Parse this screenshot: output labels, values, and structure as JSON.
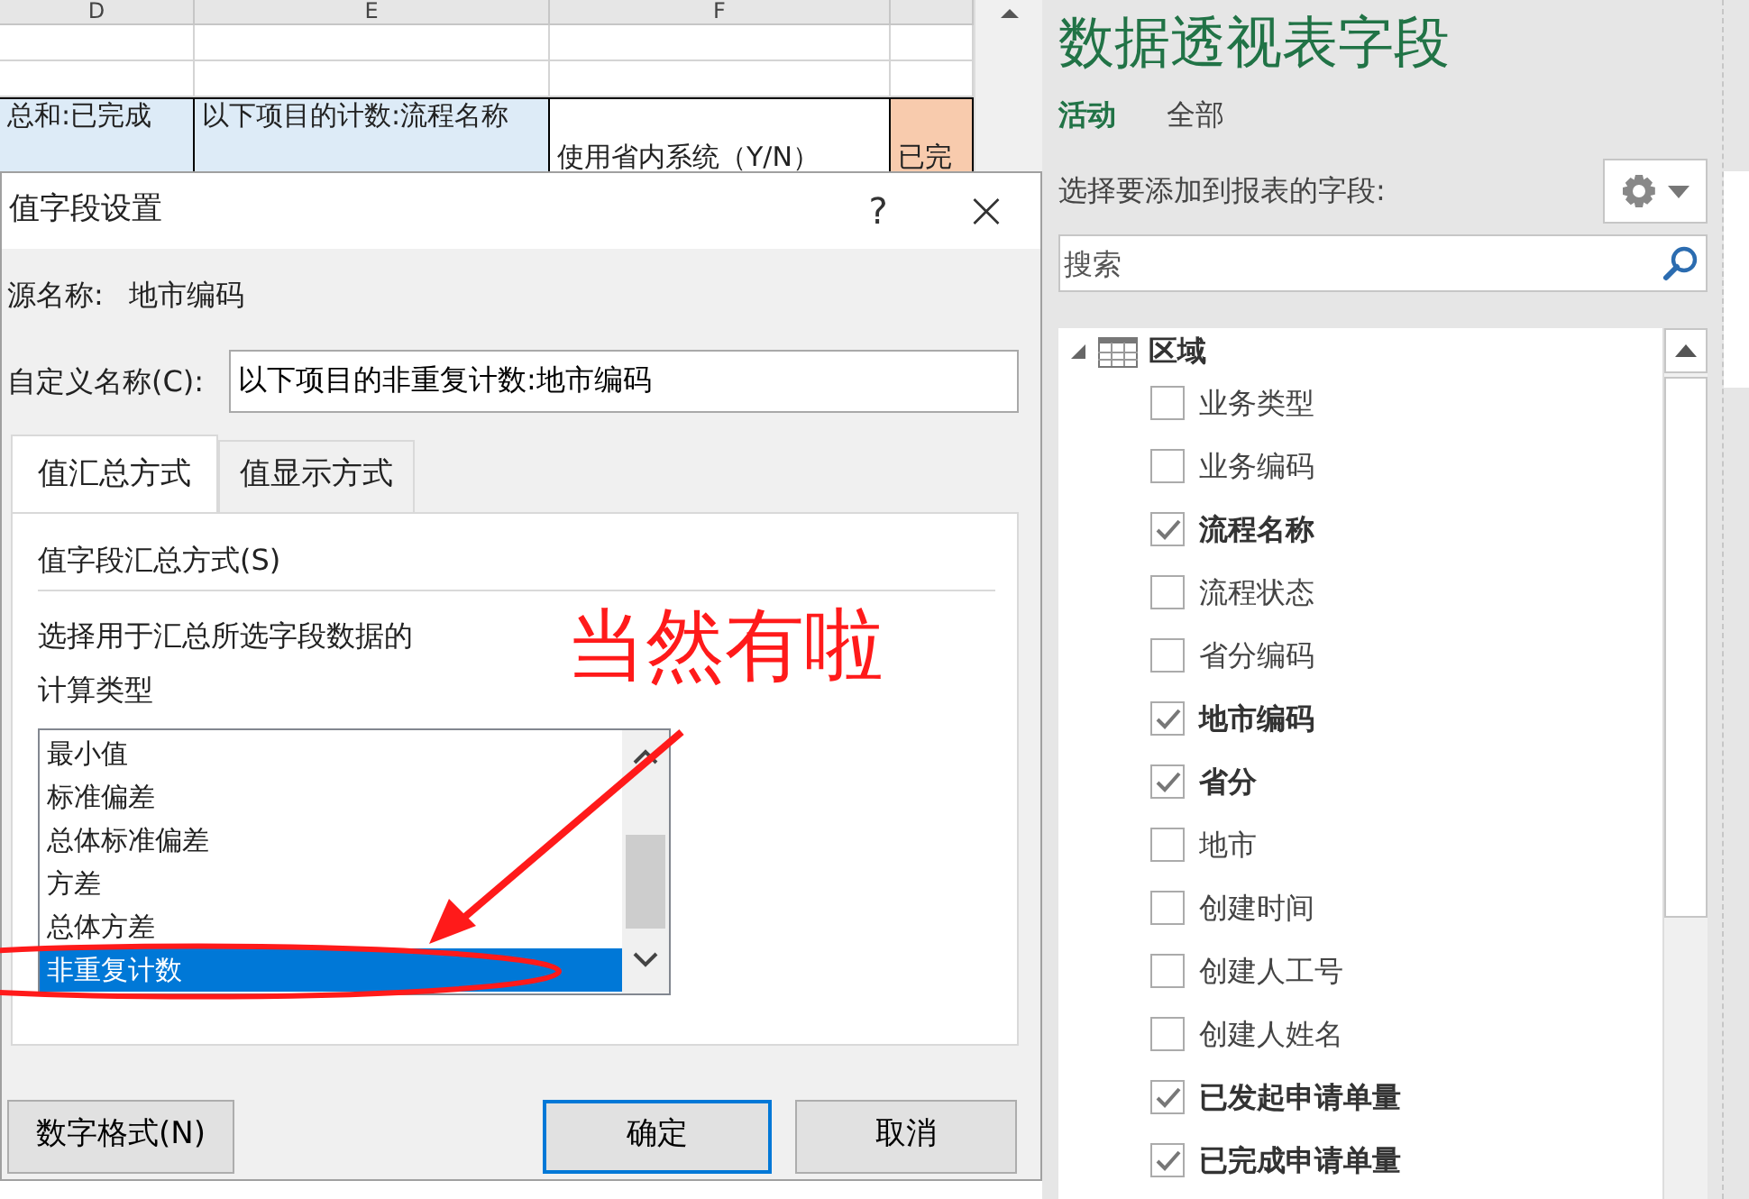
{
  "spreadsheet": {
    "columns": [
      "D",
      "E",
      "F"
    ],
    "header_cells": [
      {
        "text": "总和:已完成",
        "kind": "value"
      },
      {
        "text": "以下项目的计数:流程名称",
        "kind": "value"
      },
      {
        "text": "使用省内系统（Y/N）",
        "kind": "plain"
      },
      {
        "text": "已完",
        "kind": "accent"
      }
    ]
  },
  "dialog": {
    "title": "值字段设置",
    "help": "?",
    "close": "×",
    "source_label": "源名称:",
    "source_value": "地市编码",
    "custom_name_label": "自定义名称(C):",
    "custom_name_value": "以下项目的非重复计数:地市编码",
    "tabs": [
      {
        "label": "值汇总方式",
        "selected": true
      },
      {
        "label": "值显示方式",
        "selected": false
      }
    ],
    "section_title": "值字段汇总方式(S)",
    "description": "选择用于汇总所选字段数据的计算类型",
    "functions": [
      {
        "label": "最小值",
        "selected": false
      },
      {
        "label": "标准偏差",
        "selected": false
      },
      {
        "label": "总体标准偏差",
        "selected": false
      },
      {
        "label": "方差",
        "selected": false
      },
      {
        "label": "总体方差",
        "selected": false
      },
      {
        "label": "非重复计数",
        "selected": true
      }
    ],
    "buttons": [
      {
        "label": "数字格式(N)",
        "default": false
      },
      {
        "label": "确定",
        "default": true
      },
      {
        "label": "取消",
        "default": false
      }
    ]
  },
  "annotation": {
    "text": "当然有啦"
  },
  "pivot_pane": {
    "title": "数据透视表字段",
    "tabs": [
      {
        "label": "活动",
        "selected": true
      },
      {
        "label": "全部",
        "selected": false
      }
    ],
    "prompt": "选择要添加到报表的字段:",
    "search": {
      "placeholder": "搜索"
    },
    "tree": [
      {
        "label": "区域",
        "expanded": true,
        "children": [
          {
            "label": "业务类型",
            "checked": false
          },
          {
            "label": "业务编码",
            "checked": false
          },
          {
            "label": "流程名称",
            "checked": true
          },
          {
            "label": "流程状态",
            "checked": false
          },
          {
            "label": "省分编码",
            "checked": false
          },
          {
            "label": "地市编码",
            "checked": true
          },
          {
            "label": "省分",
            "checked": true
          },
          {
            "label": "地市",
            "checked": false
          },
          {
            "label": "创建时间",
            "checked": false
          },
          {
            "label": "创建人工号",
            "checked": false
          },
          {
            "label": "创建人姓名",
            "checked": false
          },
          {
            "label": "已发起申请单量",
            "checked": true
          },
          {
            "label": "已完成申请单量",
            "checked": true
          }
        ]
      }
    ]
  }
}
